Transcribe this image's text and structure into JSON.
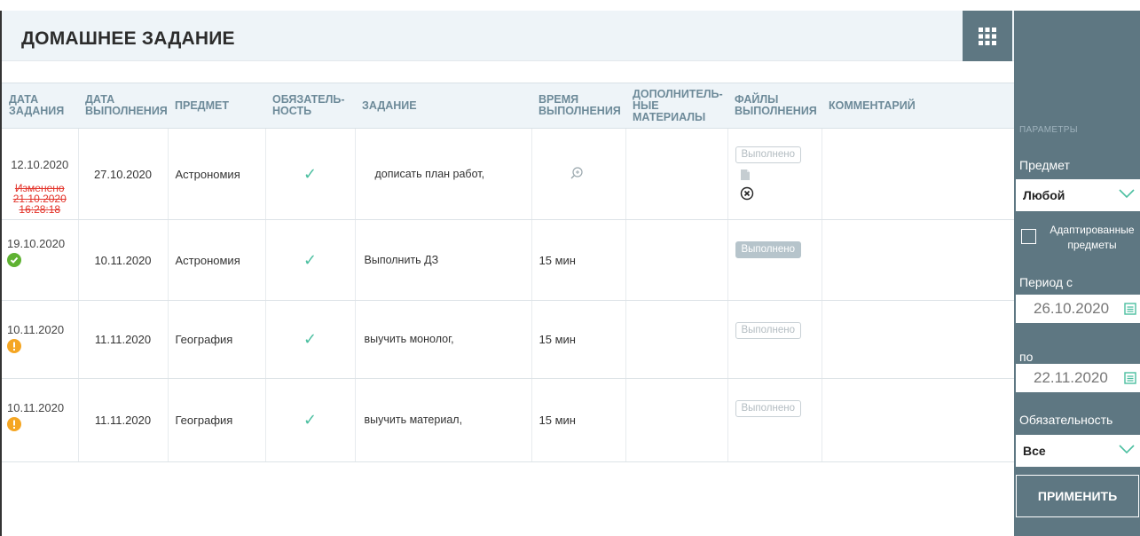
{
  "header": {
    "title": "ДОМАШНЕЕ ЗАДАНИЕ"
  },
  "table": {
    "columns": {
      "date_assigned": "ДАТА ЗАДАНИЯ",
      "date_due": "ДАТА ВЫПОЛНЕНИЯ",
      "subject": "ПРЕДМЕТ",
      "mandatory": "ОБЯЗАТЕЛЬ-НОСТЬ",
      "task": "ЗАДАНИЕ",
      "time": "ВРЕМЯ ВЫПОЛНЕНИЯ",
      "materials": "ДОПОЛНИТЕЛЬ-НЫЕ МАТЕРИАЛЫ",
      "files": "ФАЙЛЫ ВЫПОЛНЕНИЯ",
      "comment": "КОММЕНТАРИЙ"
    },
    "rows": [
      {
        "date_assigned": "12.10.2020",
        "changed": "Изменено 21.10.2020 16:28:18",
        "date_due": "27.10.2020",
        "subject": "Астрономия",
        "mandatory": "✓",
        "task": "дописать план работ,",
        "time": "",
        "status": "Выполнено",
        "status_state": "outline"
      },
      {
        "date_assigned": "19.10.2020",
        "date_due": "10.11.2020",
        "subject": "Астрономия",
        "mandatory": "✓",
        "task": "Выполнить ДЗ",
        "time": "15 мин",
        "status": "Выполнено",
        "status_state": "filled"
      },
      {
        "date_assigned": "10.11.2020",
        "date_due": "11.11.2020",
        "subject": "География",
        "mandatory": "✓",
        "task": "выучить монолог,",
        "time": "15 мин",
        "status": "Выполнено",
        "status_state": "outline"
      },
      {
        "date_assigned": "10.11.2020",
        "date_due": "11.11.2020",
        "subject": "География",
        "mandatory": "✓",
        "task": "выучить материал,",
        "time": "15 мин",
        "status": "Выполнено",
        "status_state": "outline"
      }
    ]
  },
  "sidebar": {
    "params_label": "ПАРАМЕТРЫ",
    "subject_label": "Предмет",
    "subject_value": "Любой",
    "adapted_label": "Адаптированные предметы",
    "period_from_label": "Период с",
    "period_from_value": "26.10.2020",
    "period_to_label": "по",
    "period_to_value": "22.11.2020",
    "mandatory_label": "Обязательность",
    "mandatory_value": "Все",
    "apply_label": "ПРИМЕНИТЬ"
  },
  "colors": {
    "sidebar_bg": "#5e7782",
    "header_bg": "#eef4f8",
    "check": "#4bbfa0",
    "changed": "#e3342b",
    "ok": "#5fb232",
    "warn": "#f5a623"
  }
}
